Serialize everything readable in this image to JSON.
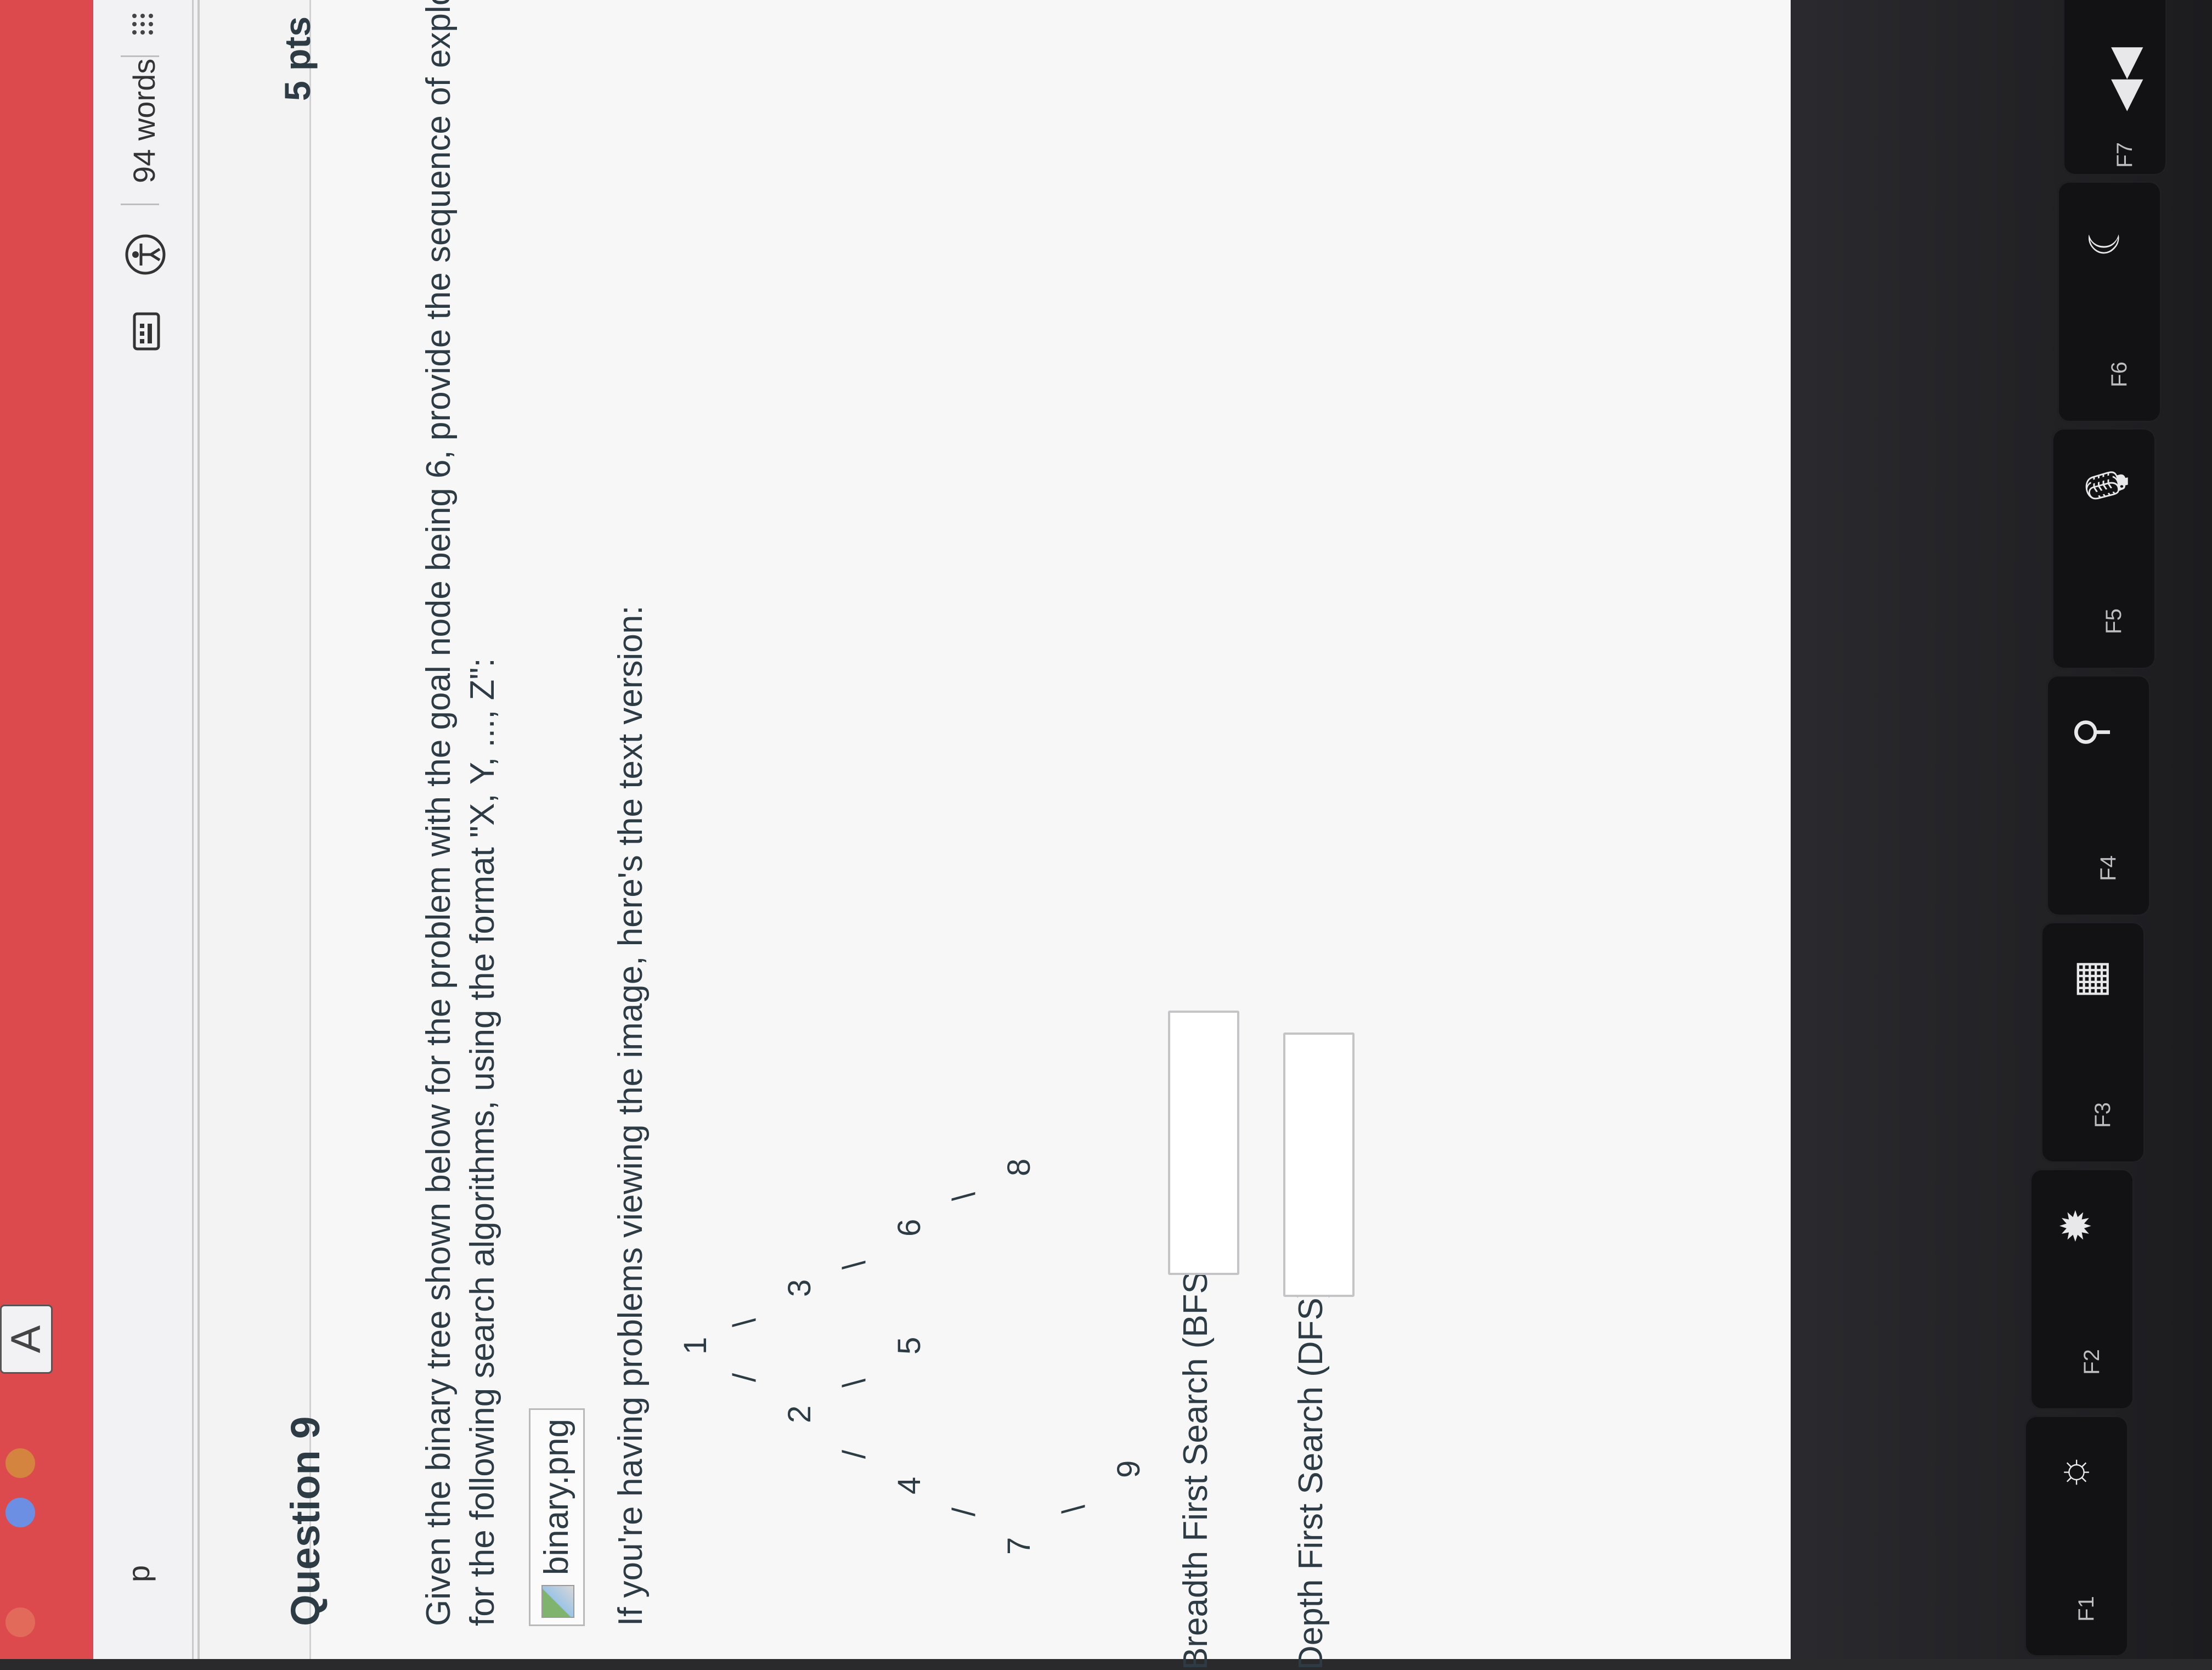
{
  "browser": {
    "tab_letter": "A"
  },
  "editor_status": {
    "paragraph_indicator": "p",
    "word_count": "94 words",
    "icons": [
      "keyboard-icon",
      "accessibility-icon",
      "drag-handle-icon"
    ]
  },
  "question": {
    "title": "Question 9",
    "points": "5 pts",
    "prompt_line1": "Given the binary tree shown below for the problem with the goal node being 6, provide the sequence of explored nodes",
    "prompt_line2": "for the following search algorithms, using the format \"X, Y, ..., Z\":",
    "image_link": "binary.png",
    "text_version_intro": "If you're having problems viewing the image, here's the text version:",
    "tree_text": {
      "n1": "1",
      "n2": "2",
      "n3": "3",
      "n4": "4",
      "n5": "5",
      "n6": "6",
      "n7": "7",
      "n8": "8",
      "n9": "9",
      "slash": "/",
      "backslash": "\\"
    },
    "answers": {
      "bfs_label": "Breadth First Search (BFS):",
      "dfs_label": "Depth First Search (DFS):",
      "bfs_value": "",
      "dfs_value": ""
    }
  },
  "keyboard": {
    "fn_labels": [
      "F1",
      "F2",
      "F3",
      "F4",
      "F5",
      "F6",
      "F7"
    ],
    "icons": [
      "brightness-down-icon",
      "brightness-up-icon",
      "mission-control-icon",
      "search-icon",
      "microphone-icon",
      "do-not-disturb-icon",
      "rewind-icon",
      "play-pause-icon"
    ]
  },
  "colors": {
    "canvas_red": "#dd4a4e",
    "text_dark": "#2d3b45",
    "keyboard": "#121214"
  }
}
